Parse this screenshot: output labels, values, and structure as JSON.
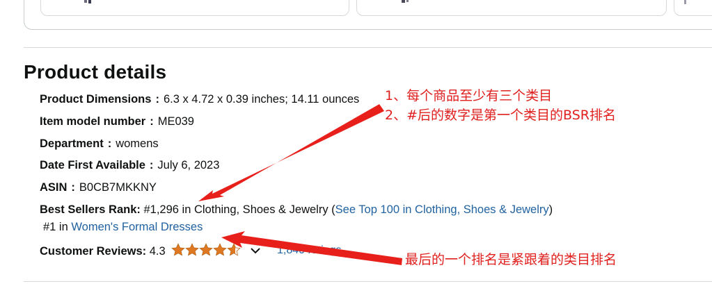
{
  "details": {
    "title": "Product details",
    "rows": [
      {
        "label": "Product Dimensions",
        "value": "6.3 x 4.72 x 0.39 inches; 14.11 ounces"
      },
      {
        "label": "Item model number",
        "value": "ME039"
      },
      {
        "label": "Department",
        "value": "womens"
      },
      {
        "label": "Date First Available",
        "value": "July 6, 2023"
      },
      {
        "label": "ASIN",
        "value": "B0CB7MKKNY"
      }
    ],
    "bsr": {
      "label": "Best Sellers Rank:",
      "rank_text": "#1,296 in Clothing, Shoes & Jewelry (",
      "top100_link": "See Top 100 in Clothing, Shoes & Jewelry",
      "close_paren": ")",
      "sub_rank_text": "#1 in",
      "sub_category_link": "Women's Formal Dresses"
    },
    "reviews": {
      "label": "Customer Reviews:",
      "rating": "4.3",
      "rating_value": 4.3,
      "ratings_count": "1,840 ratings"
    }
  },
  "annotations": {
    "note_1": "1、每个商品至少有三个类目",
    "note_2": "2、#后的数字是第一个类目的BSR排名",
    "note_3": "最后的一个排名是紧跟着的类目排名"
  },
  "colors": {
    "link": "#2162a1",
    "star": "#de7921",
    "annotation": "#e0201e"
  }
}
